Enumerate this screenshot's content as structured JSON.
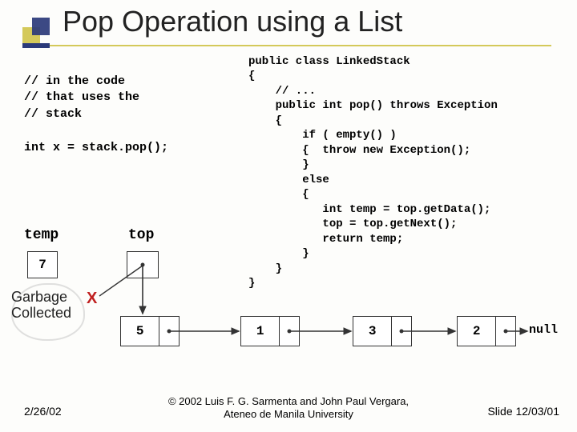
{
  "title": "Pop Operation using a List",
  "left_comment": "// in the code\n// that uses the\n// stack",
  "left_call": "int x = stack.pop();",
  "right_code": "public class LinkedStack\n{\n    // ...\n    public int pop() throws Exception\n    {\n        if ( empty() )\n        {  throw new Exception();\n        }\n        else\n        {\n           int temp = top.getData();\n           top = top.getNext();\n           return temp;\n        }\n    }\n}",
  "diagram": {
    "temp_label": "temp",
    "top_label": "top",
    "temp_value": "7",
    "garbage_label_line1": "Garbage",
    "garbage_label_line2": "Collected",
    "redx": "X",
    "nodes": [
      "7",
      "5",
      "1",
      "3",
      "2"
    ],
    "null_label": "null"
  },
  "footer": {
    "left": "2/26/02",
    "center_line1": "© 2002 Luis F. G. Sarmenta and John Paul Vergara,",
    "center_line2": "Ateneo de Manila University",
    "right": "Slide 12/03/01"
  }
}
